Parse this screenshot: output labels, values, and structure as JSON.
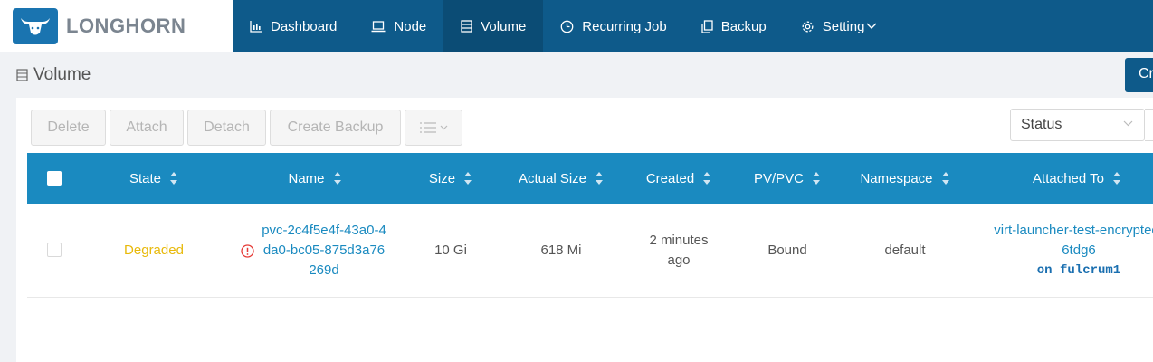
{
  "app": {
    "logo_text": "LONGHORN",
    "accent_color": "#0e5a8a",
    "header_color": "#1a8ac0"
  },
  "nav": {
    "items": [
      {
        "label": "Dashboard",
        "icon": "bar-chart-icon"
      },
      {
        "label": "Node",
        "icon": "laptop-icon"
      },
      {
        "label": "Volume",
        "icon": "database-icon",
        "active": true
      },
      {
        "label": "Recurring Job",
        "icon": "clock-icon"
      },
      {
        "label": "Backup",
        "icon": "copy-icon"
      },
      {
        "label": "Setting",
        "icon": "gear-icon"
      }
    ]
  },
  "page": {
    "title": "Volume",
    "create_label": "Create Volume"
  },
  "toolbar": {
    "delete": "Delete",
    "attach": "Attach",
    "detach": "Detach",
    "create_backup": "Create Backup",
    "filter_placeholder": "Status"
  },
  "table": {
    "columns": [
      "State",
      "Name",
      "Size",
      "Actual Size",
      "Created",
      "PV/PVC",
      "Namespace",
      "Attached To"
    ],
    "rows": [
      {
        "state": "Degraded",
        "name_lines": [
          "pvc-2c4f5e4f-43a0-4",
          "da0-bc05-875d3a76",
          "269d"
        ],
        "size": "10 Gi",
        "actual_size": "618 Mi",
        "created_lines": [
          "2 minutes",
          "ago"
        ],
        "pv_pvc": "Bound",
        "namespace": "default",
        "attached_lines": [
          "virt-launcher-test-encrypted-",
          "6tdg6"
        ],
        "attached_node": "on fulcrum1"
      }
    ]
  }
}
